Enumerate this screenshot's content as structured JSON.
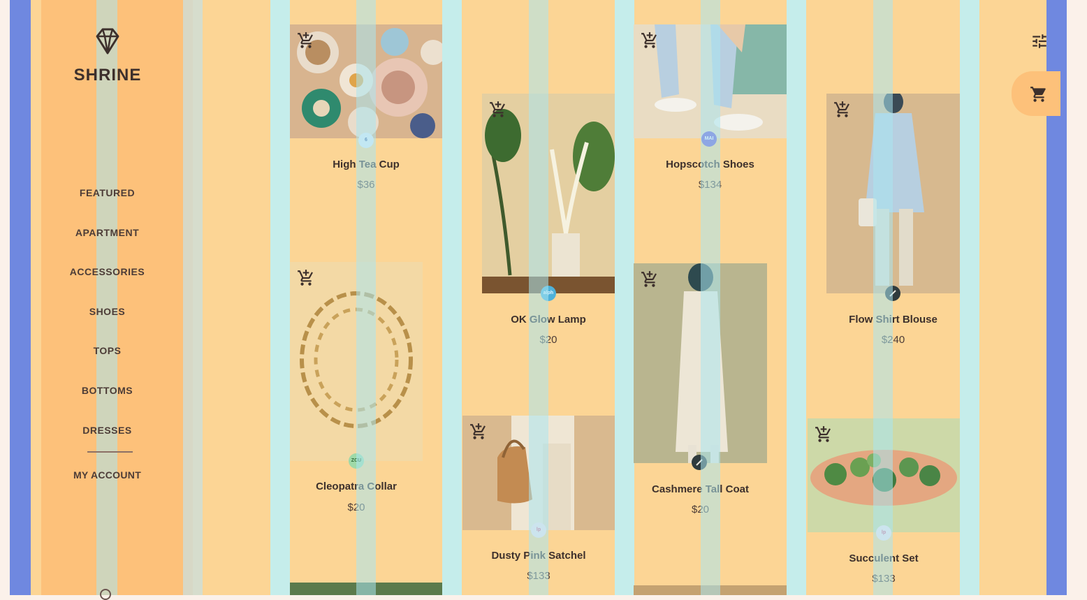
{
  "app": {
    "brand": "SHRINE",
    "logo_icon": "diamond-icon"
  },
  "menu": {
    "items": [
      "FEATURED",
      "APARTMENT",
      "ACCESSORIES",
      "SHOES",
      "TOPS",
      "BOTTOMS",
      "DRESSES"
    ],
    "account": "MY ACCOUNT"
  },
  "colors": {
    "frame": "#6f88e0",
    "canvas": "#fcd595",
    "sidebar": "#fdc17a",
    "overlay_column": "#bfeff4"
  },
  "products": [
    {
      "name": "High Tea Cup",
      "price": "$36",
      "vendor": "6"
    },
    {
      "name": "Cleopatra Collar",
      "price": "$20",
      "vendor": "ZCU"
    },
    {
      "name": "OK Glow Lamp",
      "price": "$20",
      "vendor": "alph"
    },
    {
      "name": "Dusty Pink Satchel",
      "price": "$133",
      "vendor": "lp"
    },
    {
      "name": "Hopscotch Shoes",
      "price": "$134",
      "vendor": "MAI"
    },
    {
      "name": "Cashmere Tall Coat",
      "price": "$20",
      "vendor": ""
    },
    {
      "name": "Flow Shirt Blouse",
      "price": "$240",
      "vendor": ""
    },
    {
      "name": "Succulent Set",
      "price": "$133",
      "vendor": "lp"
    }
  ],
  "icons": {
    "add_to_cart": "add-shopping-cart-icon",
    "filter": "tune-icon",
    "cart": "shopping-cart-icon",
    "search": "search-icon"
  }
}
